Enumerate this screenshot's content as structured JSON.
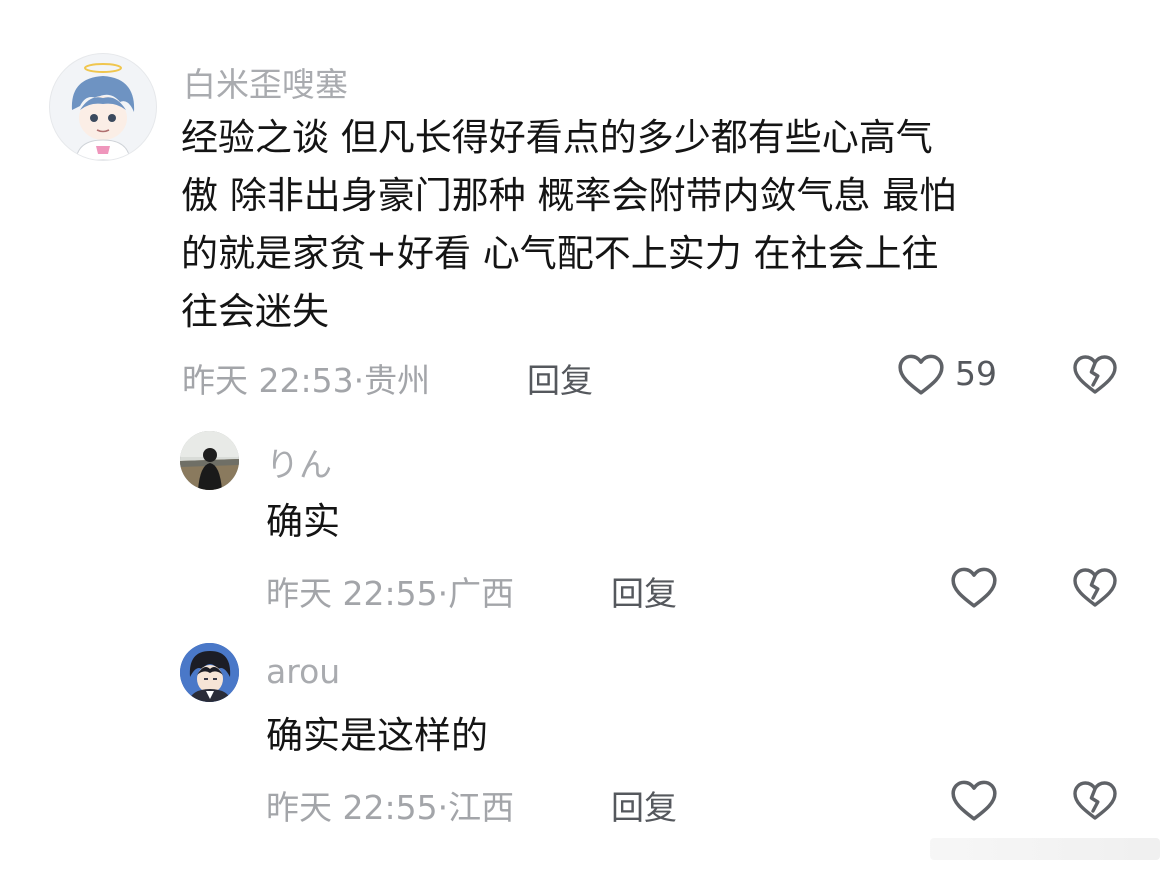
{
  "comment": {
    "username": "白米歪嗖塞",
    "lines": [
      "经验之谈 但凡长得好看点的多少都有些心高气",
      "傲 除非出身豪门那种 概率会附带内敛气息 最怕",
      "的就是家贫+好看 心气配不上实力 在社会上往",
      "往会迷失"
    ],
    "time": "昨天 22:53",
    "location": "贵州",
    "reply_label": "回复",
    "like_count": "59",
    "like_icon": "heart-outline-icon",
    "dislike_icon": "broken-heart-icon"
  },
  "replies": [
    {
      "username": "りん",
      "text": "确实",
      "time": "昨天 22:55",
      "location": "广西",
      "reply_label": "回复"
    },
    {
      "username": "arou",
      "text": "确实是这样的",
      "time": "昨天 22:55",
      "location": "江西",
      "reply_label": "回复"
    }
  ],
  "watermark": "",
  "colors": {
    "text": "#141414",
    "username": "#a9abaf",
    "meta": "#a3a5a9",
    "action": "#55585d",
    "icon_stroke": "#5f6267"
  }
}
